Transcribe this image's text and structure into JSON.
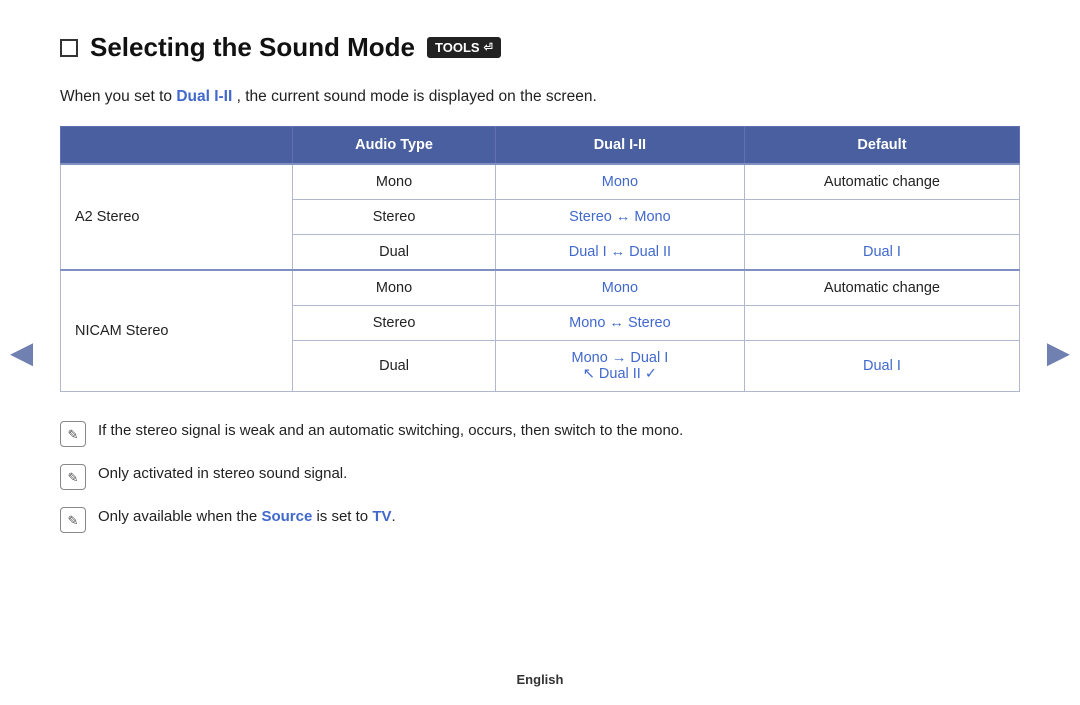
{
  "page": {
    "title": "Selecting the Sound Mode",
    "tools_badge": "TOOLS",
    "intro": {
      "prefix": "When you set to ",
      "highlight": "Dual I-II",
      "suffix": ", the current sound mode is displayed on the screen."
    },
    "table": {
      "headers": [
        "",
        "Audio Type",
        "Dual I-II",
        "Default"
      ],
      "rows": [
        {
          "group": "A2 Stereo",
          "entries": [
            {
              "audio_type": "Mono",
              "dual": "Mono",
              "dual_blue": true,
              "default": "Automatic change",
              "default_blue": false
            },
            {
              "audio_type": "Stereo",
              "dual": "Stereo ↔ Mono",
              "dual_blue": true,
              "default": "",
              "default_blue": false
            },
            {
              "audio_type": "Dual",
              "dual": "Dual I ↔ Dual II",
              "dual_blue": true,
              "default": "Dual I",
              "default_blue": true
            }
          ]
        },
        {
          "group": "NICAM Stereo",
          "entries": [
            {
              "audio_type": "Mono",
              "dual": "Mono",
              "dual_blue": true,
              "default": "Automatic change",
              "default_blue": false
            },
            {
              "audio_type": "Stereo",
              "dual": "Mono ↔ Stereo",
              "dual_blue": true,
              "default": "",
              "default_blue": false
            },
            {
              "audio_type": "Dual",
              "dual": "Mono → Dual I",
              "dual2": "↖ Dual II ✓",
              "dual_blue": true,
              "default": "Dual I",
              "default_blue": true
            }
          ]
        }
      ]
    },
    "notes": [
      "If the stereo signal is weak and an automatic switching, occurs, then switch to the mono.",
      "Only activated in stereo sound signal.",
      {
        "prefix": "Only available when the ",
        "highlight1": "Source",
        "middle": " is set to ",
        "highlight2": "TV",
        "suffix": "."
      }
    ],
    "footer": "English",
    "nav": {
      "left": "◀",
      "right": "▶"
    }
  }
}
